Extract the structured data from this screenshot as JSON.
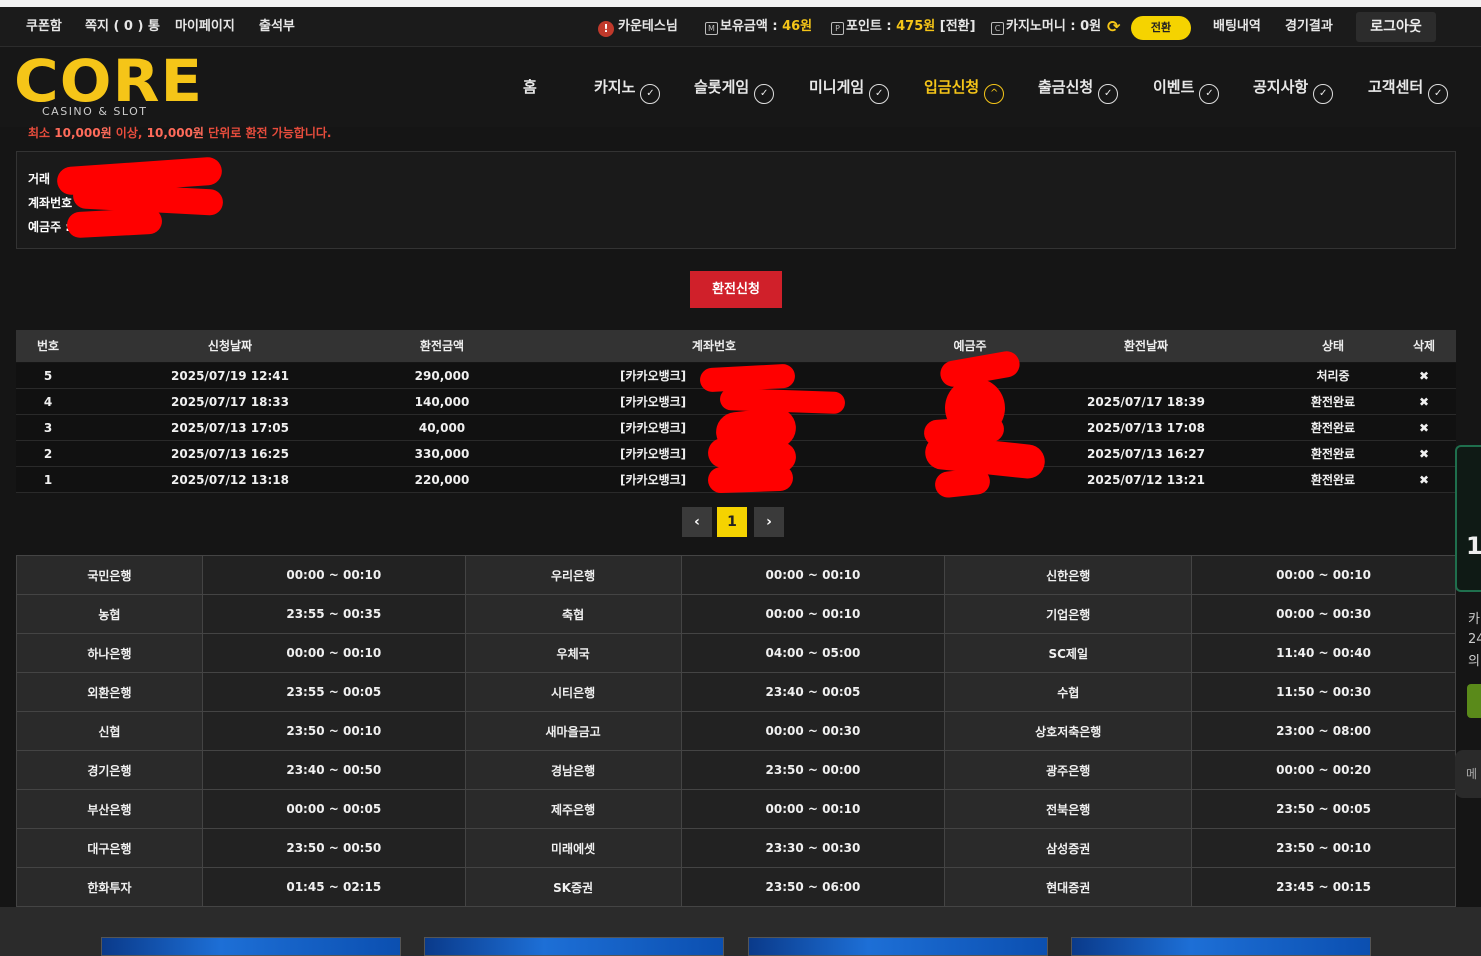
{
  "topbar": {
    "left_links": [
      "쿠폰함",
      "쪽지 ( 0 ) 통",
      "마이페이지",
      "출석부"
    ],
    "user_name": "카운테스님",
    "balance_label": "보유금액 : ",
    "balance_value": "46원",
    "points_label": "포인트 : ",
    "points_value": "475원",
    "points_suffix": " [전환]",
    "casino_money_label": "카지노머니 : ",
    "casino_money_value": "0원",
    "convert_label": "전환",
    "bet_history": "배팅내역",
    "match_results": "경기결과",
    "logout": "로그아웃"
  },
  "logo": {
    "main": "CORE",
    "sub": "CASINO & SLOT"
  },
  "nav": {
    "items": [
      {
        "label": "홈"
      },
      {
        "label": "카지노"
      },
      {
        "label": "슬롯게임"
      },
      {
        "label": "미니게임"
      },
      {
        "label": "입금신청"
      },
      {
        "label": "출금신청"
      },
      {
        "label": "이벤트"
      },
      {
        "label": "공지사항"
      },
      {
        "label": "고객센터"
      }
    ]
  },
  "notice": {
    "prefix": "최소 ",
    "amount1": "10,000원",
    "middle": " 이상, ",
    "amount2": "10,000원",
    "suffix": " 단위로 환전 가능합니다."
  },
  "account_info": {
    "line1": "거래",
    "line2": "계좌번호",
    "line3": "예금주 :"
  },
  "exchange_button": "환전신청",
  "history": {
    "headers": [
      "번호",
      "신청날짜",
      "환전금액",
      "계좌번호",
      "예금주",
      "환전날짜",
      "상태",
      "삭제"
    ],
    "rows": [
      {
        "no": "5",
        "date": "2025/07/19 12:41",
        "amount": "290,000",
        "account": "[카카오뱅크]",
        "holder": "",
        "exchanged": "",
        "status": "처리중",
        "delete": "✖"
      },
      {
        "no": "4",
        "date": "2025/07/17 18:33",
        "amount": "140,000",
        "account": "[카카오뱅크]",
        "holder": "",
        "exchanged": "2025/07/17 18:39",
        "status": "환전완료",
        "delete": "✖"
      },
      {
        "no": "3",
        "date": "2025/07/13 17:05",
        "amount": "40,000",
        "account": "[카카오뱅크]",
        "holder": "",
        "exchanged": "2025/07/13 17:08",
        "status": "환전완료",
        "delete": "✖"
      },
      {
        "no": "2",
        "date": "2025/07/13 16:25",
        "amount": "330,000",
        "account": "[카카오뱅크]",
        "holder": "",
        "exchanged": "2025/07/13 16:27",
        "status": "환전완료",
        "delete": "✖"
      },
      {
        "no": "1",
        "date": "2025/07/12 13:18",
        "amount": "220,000",
        "account": "[카카오뱅크]",
        "holder": "",
        "exchanged": "2025/07/12 13:21",
        "status": "환전완료",
        "delete": "✖"
      }
    ]
  },
  "pagination": {
    "prev": "‹",
    "current": "1",
    "next": "›"
  },
  "bank_hours": [
    [
      "국민은행",
      "00:00 ~ 00:10",
      "우리은행",
      "00:00 ~ 00:10",
      "신한은행",
      "00:00 ~ 00:10"
    ],
    [
      "농협",
      "23:55 ~ 00:35",
      "축협",
      "00:00 ~ 00:10",
      "기업은행",
      "00:00 ~ 00:30"
    ],
    [
      "하나은행",
      "00:00 ~ 00:10",
      "우체국",
      "04:00 ~ 05:00",
      "SC제일",
      "11:40 ~ 00:40"
    ],
    [
      "외환은행",
      "23:55 ~ 00:05",
      "시티은행",
      "23:40 ~ 00:05",
      "수협",
      "11:50 ~ 00:30"
    ],
    [
      "신협",
      "23:50 ~ 00:10",
      "새마을금고",
      "00:00 ~ 00:30",
      "상호저축은행",
      "23:00 ~ 08:00"
    ],
    [
      "경기은행",
      "23:40 ~ 00:50",
      "경남은행",
      "23:50 ~ 00:00",
      "광주은행",
      "00:00 ~ 00:20"
    ],
    [
      "부산은행",
      "00:00 ~ 00:05",
      "제주은행",
      "00:00 ~ 00:10",
      "전북은행",
      "23:50 ~ 00:05"
    ],
    [
      "대구은행",
      "23:50 ~ 00:50",
      "미래에셋",
      "23:30 ~ 00:30",
      "삼성증권",
      "23:50 ~ 00:10"
    ],
    [
      "한화투자",
      "01:45 ~ 02:15",
      "SK증권",
      "23:50 ~ 06:00",
      "현대증권",
      "23:45 ~ 00:15"
    ]
  ],
  "side_widget": {
    "number": "1",
    "t1": "카",
    "t2": "24",
    "t3": "의",
    "t4": "메"
  },
  "colors": {
    "accent": "#f5c518",
    "danger": "#d0202a",
    "bg": "#151515"
  },
  "icons": [
    "alert-icon",
    "wallet-icon",
    "points-icon",
    "coin-icon",
    "refresh-icon",
    "chevron-down-icon",
    "close-icon"
  ]
}
